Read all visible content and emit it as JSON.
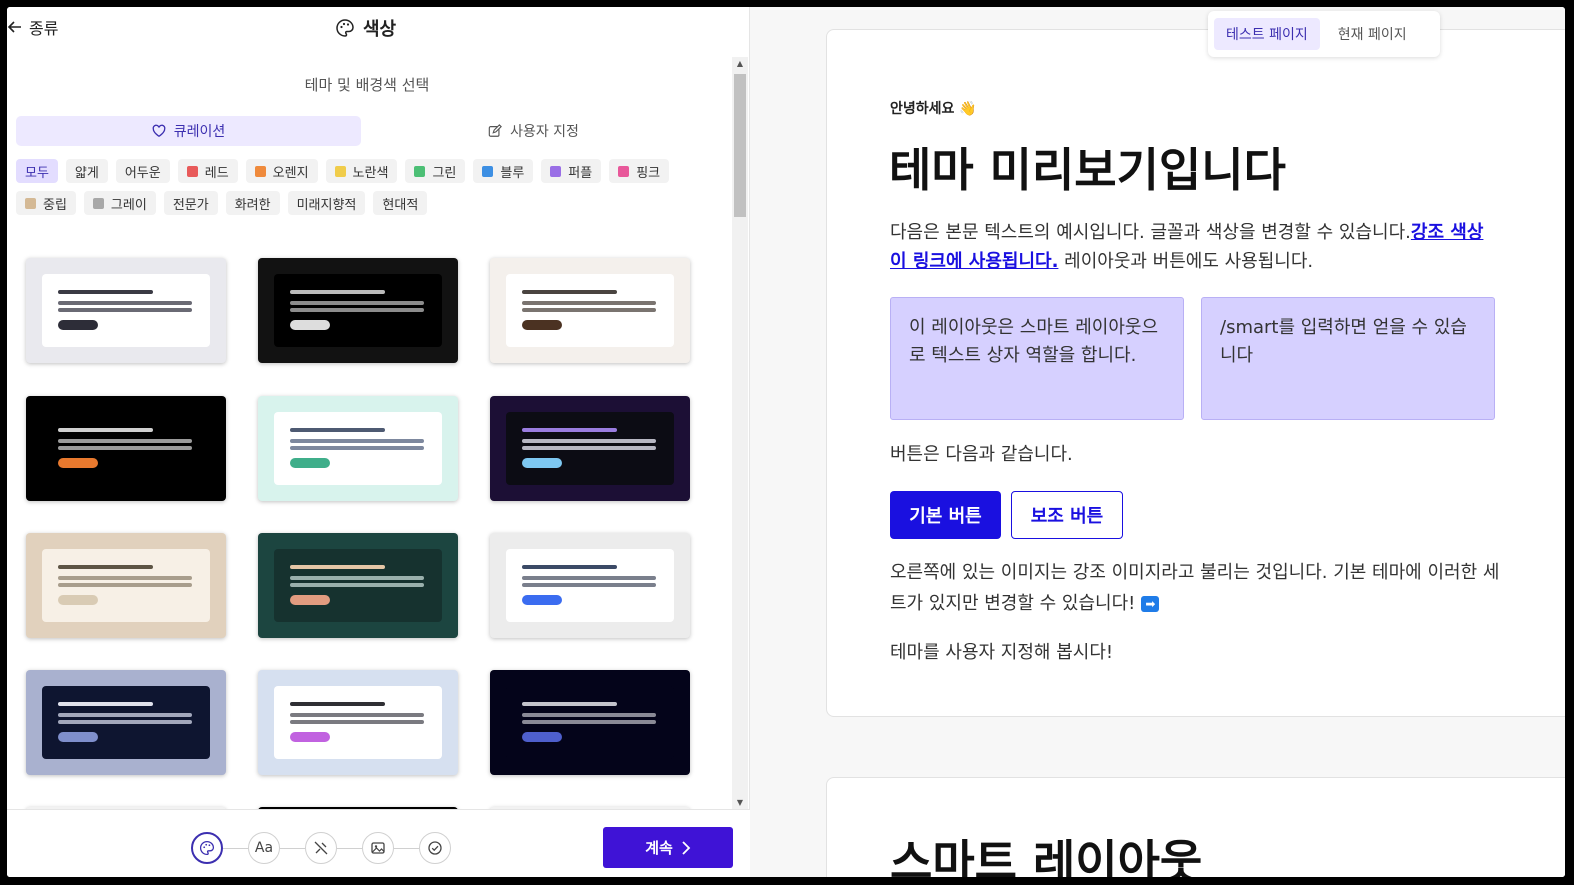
{
  "header": {
    "back_label": "종류",
    "title": "색상"
  },
  "subtitle": "테마 및 배경색 선택",
  "segments": [
    {
      "label": "큐레이션",
      "icon": "heart-icon",
      "active": true
    },
    {
      "label": "사용자 지정",
      "icon": "edit-icon",
      "active": false
    }
  ],
  "filters": [
    {
      "label": "모두",
      "color": null,
      "active": true
    },
    {
      "label": "얇게",
      "color": null
    },
    {
      "label": "어두운",
      "color": null
    },
    {
      "label": "레드",
      "color": "#e85a5a"
    },
    {
      "label": "오렌지",
      "color": "#ef8a3c"
    },
    {
      "label": "노란색",
      "color": "#f0cc4a"
    },
    {
      "label": "그린",
      "color": "#4cbf75"
    },
    {
      "label": "블루",
      "color": "#3d8fe3"
    },
    {
      "label": "퍼플",
      "color": "#9a6fe6"
    },
    {
      "label": "핑크",
      "color": "#e8589a"
    },
    {
      "label": "중립",
      "color": "#d4b995"
    },
    {
      "label": "그레이",
      "color": "#a8a8a8"
    },
    {
      "label": "전문가",
      "color": null
    },
    {
      "label": "화려한",
      "color": null
    },
    {
      "label": "미래지향적",
      "color": null
    },
    {
      "label": "현대적",
      "color": null
    }
  ],
  "themes": [
    {
      "bg": "#e9e9ee",
      "card": "#ffffff",
      "l1": "#3a3a44",
      "l2": "#6a6a74",
      "pill": "#2d2d38"
    },
    {
      "bg": "#121212",
      "card": "#000000",
      "l1": "#bbbbbb",
      "l2": "#8c8c8c",
      "pill": "#dddddd"
    },
    {
      "bg": "#f4f0ec",
      "card": "#ffffff",
      "l1": "#4a4440",
      "l2": "#7a7470",
      "pill": "#4b3222"
    },
    {
      "bg": "#000000",
      "card": "#000000",
      "l1": "#cfcfcf",
      "l2": "#9a9a9a",
      "pill": "#e8792e"
    },
    {
      "bg": "#d8f3ed",
      "card": "#ffffff",
      "l1": "#4e5a72",
      "l2": "#7d889e",
      "pill": "#3fae8a"
    },
    {
      "bg": "#1c0f35",
      "card": "#0c0c14",
      "l1": "#9a7de0",
      "l2": "#b6b6c2",
      "pill": "#7ec8f2"
    },
    {
      "bg": "#e1d1bd",
      "card": "#f7f0e6",
      "l1": "#5d5444",
      "l2": "#a89d8c",
      "pill": "#d9cbb4"
    },
    {
      "bg": "#1c4540",
      "card": "#16322f",
      "l1": "#e4c6a6",
      "l2": "#9ab0ac",
      "pill": "#e19c80"
    },
    {
      "bg": "#ececec",
      "card": "#ffffff",
      "l1": "#3b4a66",
      "l2": "#7a7f8c",
      "pill": "#3b6cf0"
    },
    {
      "bg": "#a9b1cf",
      "card": "#0e1530",
      "l1": "#e0e2ec",
      "l2": "#a2a7bb",
      "pill": "#7f8fcc"
    },
    {
      "bg": "#d6e0f0",
      "card": "#ffffff",
      "l1": "#2f2f34",
      "l2": "#7a7a80",
      "pill": "#c162e0"
    },
    {
      "bg": "#04041a",
      "card": "#04041a",
      "l1": "#c4c4cc",
      "l2": "#8a8a96",
      "pill": "#4e5fcc"
    }
  ],
  "steps": [
    "palette-icon",
    "Aa",
    "brush-icon",
    "image-icon",
    "check-icon"
  ],
  "continue_label": "계속",
  "preview_toggle": [
    {
      "label": "테스트 페이지",
      "active": true
    },
    {
      "label": "현재 페이지",
      "active": false
    }
  ],
  "preview": {
    "greeting": "안녕하세요 👋",
    "heading": "테마 미리보기입니다",
    "body_text": "다음은 본문 텍스트의 예시입니다. 글꼴과 색상을 변경할 수 있습니다.",
    "link_text": "강조 색상이 링크에 사용됩니다.",
    "body_text_after": " 레이아웃과 버튼에도 사용됩니다.",
    "box1": "이 레이아웃은 스마트 레이아웃으로 텍스트 상자 역할을 합니다.",
    "box2": "/smart를 입력하면 얻을 수 있습니다",
    "buttons_intro": "버튼은 다음과 같습니다.",
    "primary_button": "기본 버튼",
    "secondary_button": "보조 버튼",
    "accent_text": "오른쪽에 있는 이미지는 강조 이미지라고 불리는 것입니다. 기본 테마에 이러한 세트가 있지만 변경할 수 있습니다!",
    "accent_emoji": "➡",
    "customize_text": "테마를 사용자 지정해 봅시다!",
    "next_heading": "스마트 레이아웃"
  },
  "colors": {
    "accent": "#1a10e0",
    "brand": "#3f13d6",
    "box_fill": "#d6d0ff"
  }
}
